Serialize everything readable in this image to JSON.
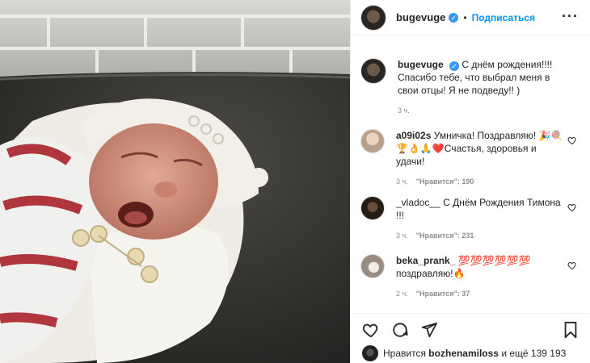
{
  "post": {
    "author": "bugevuge",
    "follow_label": "Подписаться",
    "separator": "•",
    "verified_mark": "✓"
  },
  "caption": {
    "author": "bugevuge",
    "text": "С днём рождения!!!! Спасибо тебе, что выбрал меня в свои отцы! Я не подведу!! )",
    "time": "3 ч."
  },
  "comments": [
    {
      "author": "a09i02s",
      "text": "Умничка! Поздравляю! 🎉🍭🏆👌🙏❤️Счастья, здоровья и удачи!",
      "time": "3 ч.",
      "likes": "\"Нравится\": 190"
    },
    {
      "author": "_vladoc__",
      "text": "С Днём Рождения Тимона !!!",
      "time": "3 ч.",
      "likes": "\"Нравится\": 231"
    },
    {
      "author": "beka_prank_",
      "text": "💯💯💯💯💯💯 поздравляю!🔥",
      "time": "2 ч.",
      "likes": "\"Нравится\": 37"
    }
  ],
  "likes_line": {
    "prefix": "Нравится",
    "user": "bozhenamiloss",
    "suffix": "и ещё 139 193"
  },
  "icons": {
    "like": "heart-icon",
    "comment": "comment-icon",
    "share": "share-icon",
    "save": "bookmark-icon",
    "more": "more-icon"
  }
}
